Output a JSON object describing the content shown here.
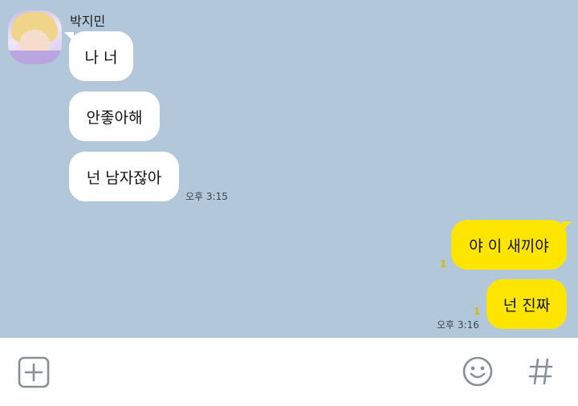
{
  "contact": {
    "name": "박지민"
  },
  "messages": {
    "incoming": [
      {
        "text": "나 너"
      },
      {
        "text": "안좋아해"
      },
      {
        "text": "넌 남자잖아"
      }
    ],
    "incoming_time": "오후 3:15",
    "outgoing": [
      {
        "text": "야 이 새끼야",
        "unread": "1"
      },
      {
        "text": "넌 진짜",
        "unread": "1"
      }
    ],
    "outgoing_time": "오후 3:16"
  },
  "input_bar": {
    "icons": [
      "plus-box-icon",
      "emoji-icon",
      "hashtag-icon"
    ]
  },
  "colors": {
    "background": "#b2c7da",
    "incoming_bubble": "#ffffff",
    "outgoing_bubble": "#fee500",
    "unread": "#d7b800"
  }
}
